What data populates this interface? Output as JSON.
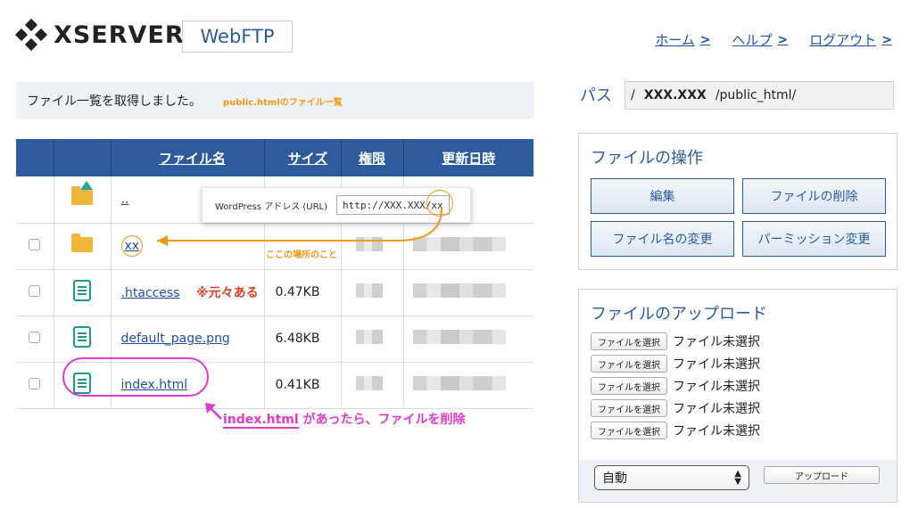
{
  "brand": {
    "logo_text": "XSERVER",
    "app_name": "WebFTP"
  },
  "nav": [
    {
      "label": "ホーム"
    },
    {
      "label": "ヘルプ"
    },
    {
      "label": "ログアウト"
    }
  ],
  "status": {
    "message": "ファイル一覧を取得しました。",
    "annotation": "public.htmlのファイル一覧"
  },
  "table": {
    "headers": {
      "name": "ファイル名",
      "size": "サイズ",
      "perm": "権限",
      "date": "更新日時"
    },
    "rows": [
      {
        "name": "..",
        "size": "",
        "type": "parent-folder"
      },
      {
        "name": "xx",
        "size": "",
        "type": "folder"
      },
      {
        "name": ".htaccess",
        "size": "0.47KB",
        "type": "file"
      },
      {
        "name": "default_page.png",
        "size": "6.48KB",
        "type": "file"
      },
      {
        "name": "index.html",
        "size": "0.41KB",
        "type": "file"
      }
    ]
  },
  "tooltip": {
    "label": "WordPress アドレス (URL)",
    "value": "http://XXX.XXX/xx"
  },
  "annotations": {
    "folder_note": "ここの場所のこと",
    "htaccess_note": "※元々ある",
    "delete_note_prefix": "index.html",
    "delete_note_suffix": " があったら、ファイルを削除"
  },
  "path": {
    "label": "パス",
    "prefix": "/",
    "host": "XXX.XXX",
    "dir": "/public_html/"
  },
  "operations": {
    "title": "ファイルの操作",
    "buttons": {
      "edit": "編集",
      "delete": "ファイルの削除",
      "rename": "ファイル名の変更",
      "permission": "パーミッション変更"
    }
  },
  "upload": {
    "title": "ファイルのアップロード",
    "choose_label": "ファイルを選択",
    "no_file_label": "ファイル未選択",
    "mode_value": "自動",
    "upload_label": "アップロード"
  },
  "colors": {
    "accent": "#2d5b9b",
    "annotation_orange": "#f19a1a",
    "annotation_magenta": "#e13bcb",
    "annotation_red": "#d9442a"
  }
}
